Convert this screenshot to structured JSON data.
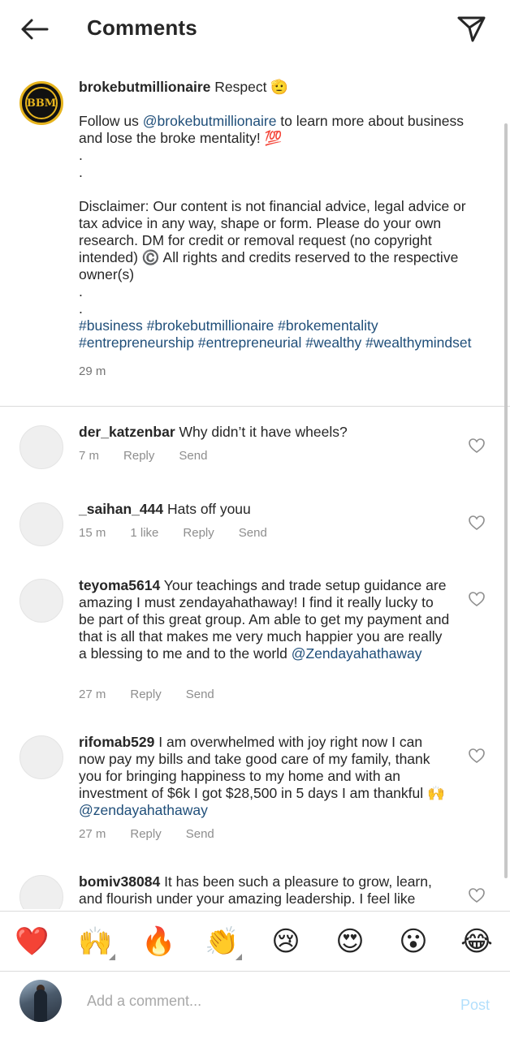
{
  "header": {
    "title": "Comments"
  },
  "caption": {
    "username": "brokebutmillionaire",
    "logo_text": "BBM",
    "line1_rest": " Respect 🫡",
    "follow_prefix": "Follow us ",
    "follow_mention": "@brokebutmillionaire",
    "follow_suffix": " to learn more about business and lose the broke mentality! 💯",
    "dot1": ".",
    "dot2": ".",
    "disclaimer": "Disclaimer: Our content is not financial advice, legal advice or tax advice in any way, shape or form. Please do your own research. DM for credit or removal request (no copyright intended) ©️ All rights and credits reserved to the respective owner(s)",
    "dot3": ".",
    "dot4": ".",
    "hashtags": "#business #brokebutmillionaire #brokementality #entrepreneurship #entrepreneurial #wealthy #wealthymindset",
    "time": "29 m"
  },
  "comments": [
    {
      "username": "der_katzenbar",
      "text": " Why didn’t it have wheels?",
      "mention": "",
      "time": "7 m",
      "likes": "",
      "reply": "Reply",
      "send": "Send"
    },
    {
      "username": "_saihan_444",
      "text": " Hats off youu",
      "mention": "",
      "time": "15 m",
      "likes": "1 like",
      "reply": "Reply",
      "send": "Send"
    },
    {
      "username": "teyoma5614",
      "text": " Your teachings and trade setup guidance are amazing I must zendayahathaway! I find it really lucky to be part of this great group. Am able to get my payment and that is all that makes me very much happier you are really a blessing to me and to the world ",
      "mention": "@Zendayahathaway",
      "time": "27 m",
      "likes": "",
      "reply": "Reply",
      "send": "Send"
    },
    {
      "username": "rifomab529",
      "text": " I am overwhelmed with joy right now I can now pay my bills and take good care of my family, thank you for bringing happiness to my home and with an investment of $6k I got $28,500 in 5 days I am thankful 🙌 ",
      "mention": "@zendayahathaway",
      "time": "27 m",
      "likes": "",
      "reply": "Reply",
      "send": "Send"
    },
    {
      "username": "bomiv38084",
      "text": " It has been such a pleasure to grow, learn, and flourish under your amazing leadership. I feel like",
      "mention": "",
      "time": "",
      "likes": "",
      "reply": "",
      "send": ""
    }
  ],
  "reactions": [
    "❤️",
    "🙌",
    "🔥",
    "👏",
    "😢",
    "😍",
    "😮",
    "😂"
  ],
  "composer": {
    "placeholder": "Add a comment...",
    "post_label": "Post"
  },
  "colors": {
    "link": "#1f4e79",
    "muted": "#8e8e8e",
    "post_disabled": "#b2dffc",
    "logo_gold": "#e6b41e"
  }
}
